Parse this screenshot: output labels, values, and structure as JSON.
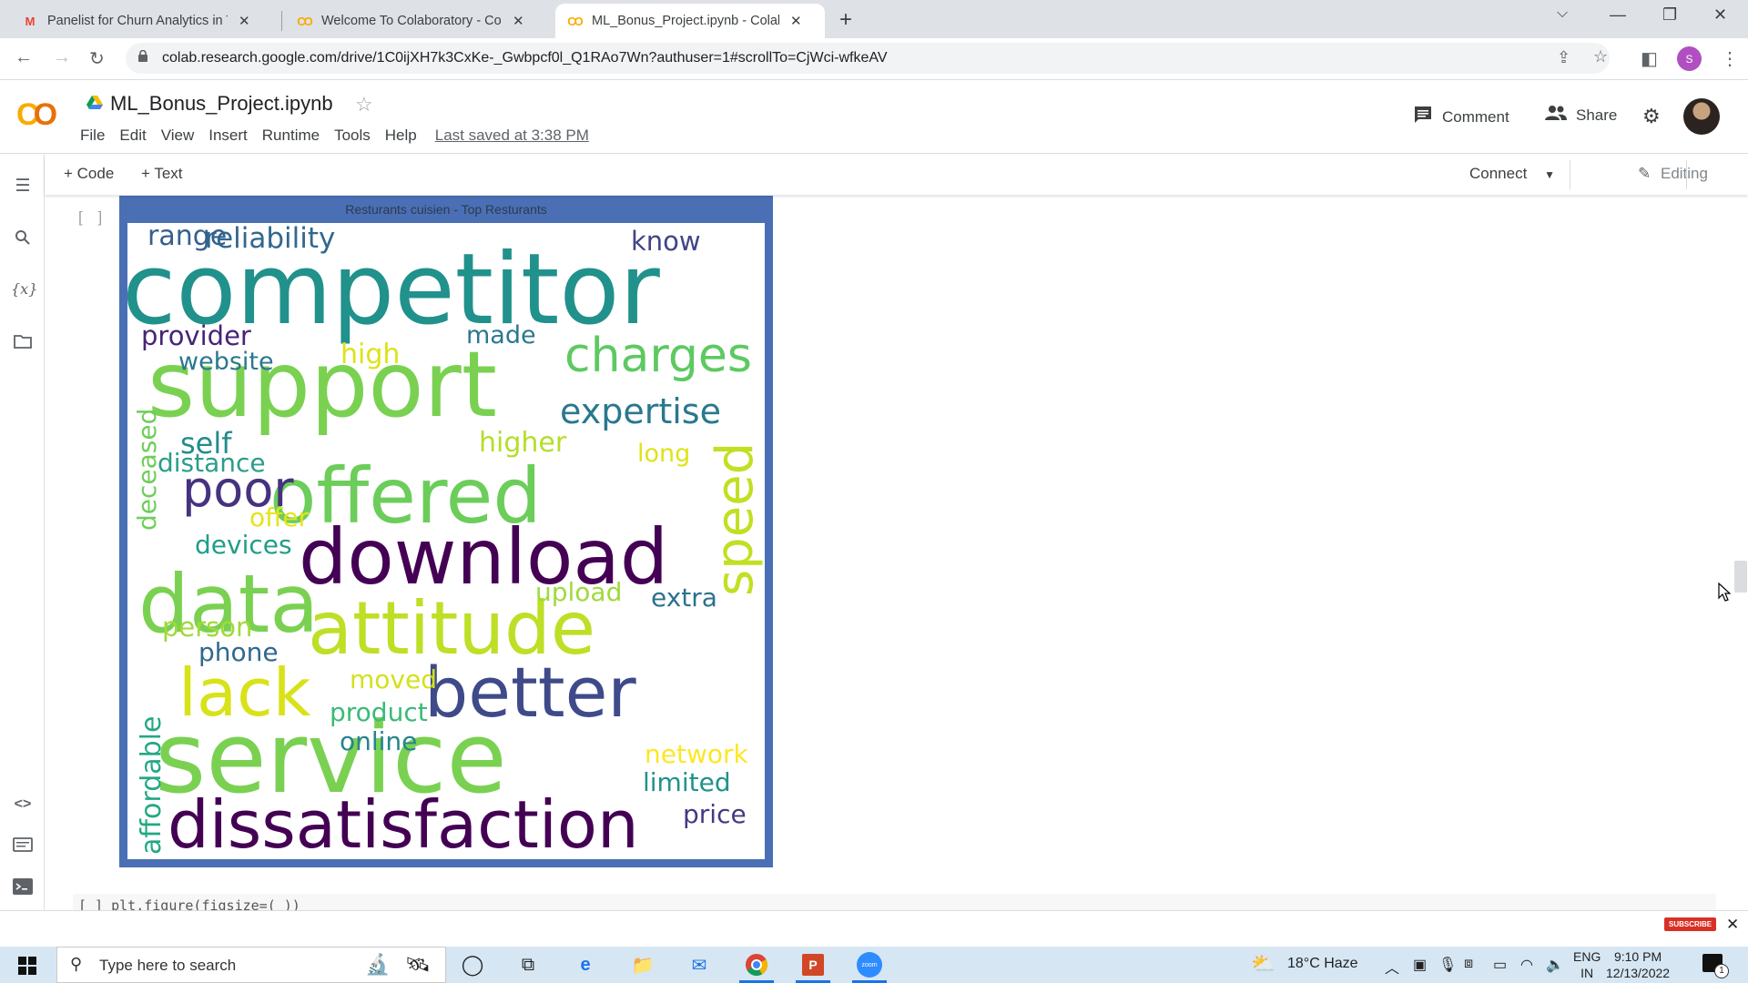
{
  "browser": {
    "tabs": [
      {
        "title": "Panelist for Churn Analytics in Te",
        "icon": "gmail-icon",
        "active": false
      },
      {
        "title": "Welcome To Colaboratory - Colal",
        "icon": "colab-icon",
        "active": false
      },
      {
        "title": "ML_Bonus_Project.ipynb - Colab",
        "icon": "colab-icon",
        "active": true
      }
    ],
    "new_tab": "+",
    "url": "colab.research.google.com/drive/1C0ijXH7k3CxKe-_Gwbpcf0l_Q1RAo7Wn?authuser=1#scrollTo=CjWci-wfkeAV",
    "profile_initial": "S"
  },
  "colab": {
    "notebook_title": "ML_Bonus_Project.ipynb",
    "menu": [
      "File",
      "Edit",
      "View",
      "Insert",
      "Runtime",
      "Tools",
      "Help"
    ],
    "last_saved": "Last saved at 3:38 PM",
    "comment_label": "Comment",
    "share_label": "Share",
    "add_code_label": "+ Code",
    "add_text_label": "+ Text",
    "connect_label": "Connect",
    "editing_label": "Editing",
    "cell_bracket": "[ ]",
    "next_cell_code": "[ ]   plt.figure(figsize=(    ))"
  },
  "chart_data": {
    "type": "wordcloud",
    "title": "Resturants cuisien -  Top Resturants",
    "colormap": "viridis",
    "background": "#ffffff",
    "words": [
      {
        "text": "competitor",
        "size_rank": 1,
        "color": "#21918c",
        "orientation": "horizontal"
      },
      {
        "text": "support",
        "size_rank": 2,
        "color": "#7ad151",
        "orientation": "horizontal"
      },
      {
        "text": "service",
        "size_rank": 3,
        "color": "#7ad151",
        "orientation": "horizontal"
      },
      {
        "text": "offered",
        "size_rank": 4,
        "color": "#6ccd5a",
        "orientation": "horizontal"
      },
      {
        "text": "download",
        "size_rank": 5,
        "color": "#440154",
        "orientation": "horizontal"
      },
      {
        "text": "data",
        "size_rank": 6,
        "color": "#7ad151",
        "orientation": "horizontal"
      },
      {
        "text": "attitude",
        "size_rank": 7,
        "color": "#bddf26",
        "orientation": "horizontal"
      },
      {
        "text": "better",
        "size_rank": 8,
        "color": "#3e4a89",
        "orientation": "horizontal"
      },
      {
        "text": "dissatisfaction",
        "size_rank": 9,
        "color": "#440154",
        "orientation": "horizontal"
      },
      {
        "text": "lack",
        "size_rank": 10,
        "color": "#d8e219",
        "orientation": "horizontal"
      },
      {
        "text": "charges",
        "size_rank": 11,
        "color": "#5ec962",
        "orientation": "horizontal"
      },
      {
        "text": "poor",
        "size_rank": 12,
        "color": "#46327e",
        "orientation": "horizontal"
      },
      {
        "text": "expertise",
        "size_rank": 13,
        "color": "#2a788e",
        "orientation": "horizontal"
      },
      {
        "text": "speed",
        "size_rank": 14,
        "color": "#c2df23",
        "orientation": "vertical"
      },
      {
        "text": "reliability",
        "size_rank": 15,
        "color": "#31688e",
        "orientation": "horizontal"
      },
      {
        "text": "provider",
        "size_rank": 16,
        "color": "#482475",
        "orientation": "horizontal"
      },
      {
        "text": "range",
        "size_rank": 17,
        "color": "#35608d",
        "orientation": "horizontal"
      },
      {
        "text": "know",
        "size_rank": 18,
        "color": "#414487",
        "orientation": "horizontal"
      },
      {
        "text": "website",
        "size_rank": 19,
        "color": "#2a788e",
        "orientation": "horizontal"
      },
      {
        "text": "made",
        "size_rank": 20,
        "color": "#2a788e",
        "orientation": "horizontal"
      },
      {
        "text": "high",
        "size_rank": 21,
        "color": "#dde318",
        "orientation": "horizontal"
      },
      {
        "text": "higher",
        "size_rank": 22,
        "color": "#b5de2b",
        "orientation": "horizontal"
      },
      {
        "text": "deceased",
        "size_rank": 23,
        "color": "#6ece58",
        "orientation": "vertical"
      },
      {
        "text": "self",
        "size_rank": 24,
        "color": "#228c8d",
        "orientation": "horizontal"
      },
      {
        "text": "distance",
        "size_rank": 25,
        "color": "#2a9d8a",
        "orientation": "horizontal"
      },
      {
        "text": "long",
        "size_rank": 26,
        "color": "#dfe318",
        "orientation": "horizontal"
      },
      {
        "text": "offer",
        "size_rank": 27,
        "color": "#e5e419",
        "orientation": "horizontal"
      },
      {
        "text": "devices",
        "size_rank": 28,
        "color": "#1f9e89",
        "orientation": "horizontal"
      },
      {
        "text": "upload",
        "size_rank": 29,
        "color": "#9fda3a",
        "orientation": "horizontal"
      },
      {
        "text": "extra",
        "size_rank": 30,
        "color": "#2c728e",
        "orientation": "horizontal"
      },
      {
        "text": "person",
        "size_rank": 31,
        "color": "#a0da39",
        "orientation": "horizontal"
      },
      {
        "text": "phone",
        "size_rank": 32,
        "color": "#31688e",
        "orientation": "horizontal"
      },
      {
        "text": "moved",
        "size_rank": 33,
        "color": "#d2e21b",
        "orientation": "horizontal"
      },
      {
        "text": "product",
        "size_rank": 34,
        "color": "#3aba76",
        "orientation": "horizontal"
      },
      {
        "text": "online",
        "size_rank": 35,
        "color": "#25858e",
        "orientation": "horizontal"
      },
      {
        "text": "affordable",
        "size_rank": 36,
        "color": "#23a884",
        "orientation": "vertical"
      },
      {
        "text": "network",
        "size_rank": 37,
        "color": "#fde725",
        "orientation": "horizontal"
      },
      {
        "text": "limited",
        "size_rank": 38,
        "color": "#20928c",
        "orientation": "horizontal"
      },
      {
        "text": "price",
        "size_rank": 39,
        "color": "#443983",
        "orientation": "horizontal"
      }
    ]
  },
  "sidebar": {
    "icons": [
      "table-of-contents-icon",
      "search-icon",
      "variables-icon",
      "files-icon",
      "code-snippets-icon",
      "command-palette-icon",
      "terminal-icon"
    ]
  },
  "status_strip": {
    "subscribe_label": "SUBSCRIBE"
  },
  "taskbar": {
    "search_placeholder": "Type here to search",
    "weather": "18°C  Haze",
    "lang_top": "ENG",
    "lang_bottom": "IN",
    "time": "9:10 PM",
    "date": "12/13/2022",
    "notification_count": "1"
  }
}
